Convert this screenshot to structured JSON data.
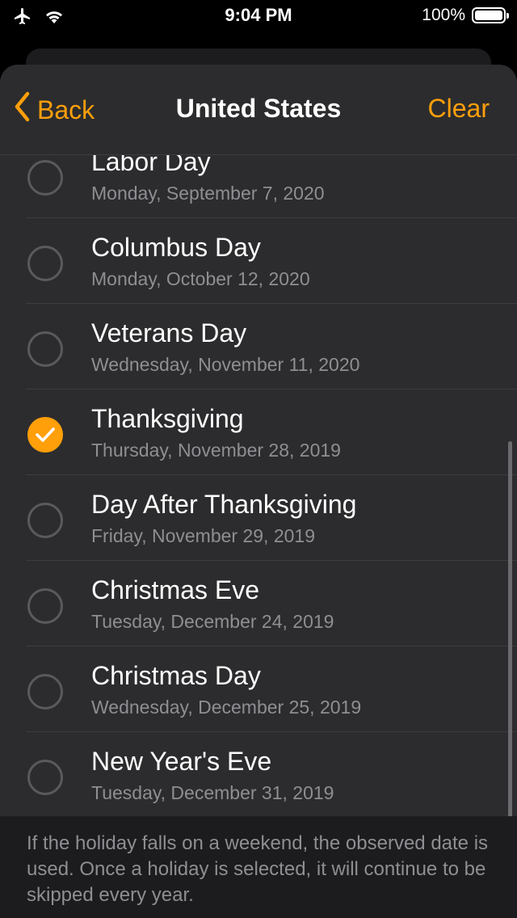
{
  "status_bar": {
    "time": "9:04 PM",
    "battery_percent": "100%",
    "battery_level": 1.0,
    "icons": [
      "airplane-icon",
      "wifi-icon",
      "battery-icon"
    ]
  },
  "nav": {
    "back_label": "Back",
    "title": "United States",
    "clear_label": "Clear"
  },
  "colors": {
    "accent": "#ff9f0a",
    "sheet_background": "#2c2c2e",
    "secondary_text": "#8e8e93"
  },
  "holidays": [
    {
      "name": "Labor Day",
      "date": "Monday, September 7, 2020",
      "selected": false
    },
    {
      "name": "Columbus Day",
      "date": "Monday, October 12, 2020",
      "selected": false
    },
    {
      "name": "Veterans Day",
      "date": "Wednesday, November 11, 2020",
      "selected": false
    },
    {
      "name": "Thanksgiving",
      "date": "Thursday, November 28, 2019",
      "selected": true
    },
    {
      "name": "Day After Thanksgiving",
      "date": "Friday, November 29, 2019",
      "selected": false
    },
    {
      "name": "Christmas Eve",
      "date": "Tuesday, December 24, 2019",
      "selected": false
    },
    {
      "name": "Christmas Day",
      "date": "Wednesday, December 25, 2019",
      "selected": false
    },
    {
      "name": "New Year's Eve",
      "date": "Tuesday, December 31, 2019",
      "selected": false
    }
  ],
  "footer": {
    "text": "If the holiday falls on a weekend, the observed date is used.  Once a holiday is selected, it will continue to be skipped every year."
  }
}
